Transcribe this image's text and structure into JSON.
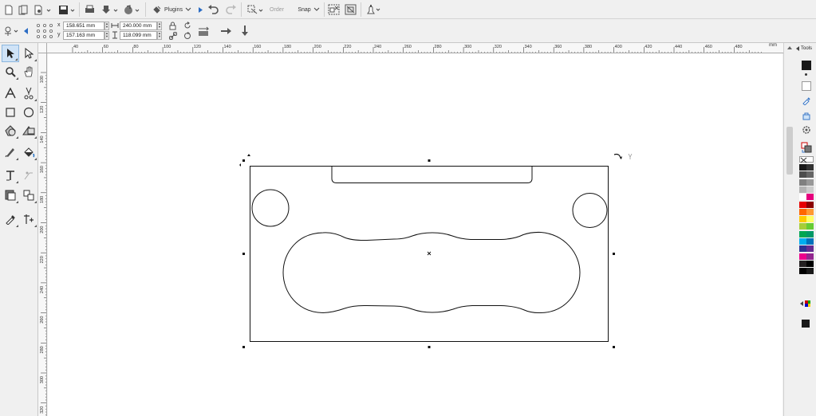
{
  "toolbar": {
    "plugins_label": "Plugins",
    "order_label": "Order",
    "snap_label": "Snap"
  },
  "properties": {
    "x_label": "x",
    "y_label": "y",
    "x_value": "158.651 mm",
    "y_value": "157.163 mm",
    "width_value": "240.000 mm",
    "height_value": "118.099 mm"
  },
  "ruler": {
    "unit": "mm",
    "top_ticks": [
      "40",
      "60",
      "80",
      "100",
      "120",
      "140",
      "160",
      "180",
      "200",
      "220",
      "240",
      "260",
      "280",
      "300",
      "320",
      "340",
      "360",
      "380",
      "400",
      "420",
      "440",
      "460",
      "480"
    ],
    "left_ticks": [
      "100",
      "120",
      "140",
      "160",
      "180",
      "200",
      "220",
      "240",
      "260",
      "280",
      "300",
      "320"
    ]
  },
  "right_panel": {
    "tools_label": "Tools"
  },
  "palette": {
    "colors": [
      "#1a1a1a",
      "#333333",
      "#4d4d4d",
      "#666666",
      "#808080",
      "#999999",
      "#b3b3b3",
      "#cccccc",
      "#ffffff",
      "#e6007e",
      "#e60000",
      "#8b0000",
      "#ff6600",
      "#ff9933",
      "#ffcc00",
      "#ffff66",
      "#a6ce39",
      "#66cc33",
      "#00a651",
      "#009966",
      "#00aeef",
      "#0072bc",
      "#2e3192",
      "#662d91",
      "#ec008c",
      "#92278f",
      "#231f20",
      "#000000",
      "#000000",
      "#1a1a1a"
    ]
  },
  "icons": {
    "pointer": "pick-tool-icon",
    "zoom": "zoom-tool-icon",
    "text": "text-tool-icon"
  }
}
